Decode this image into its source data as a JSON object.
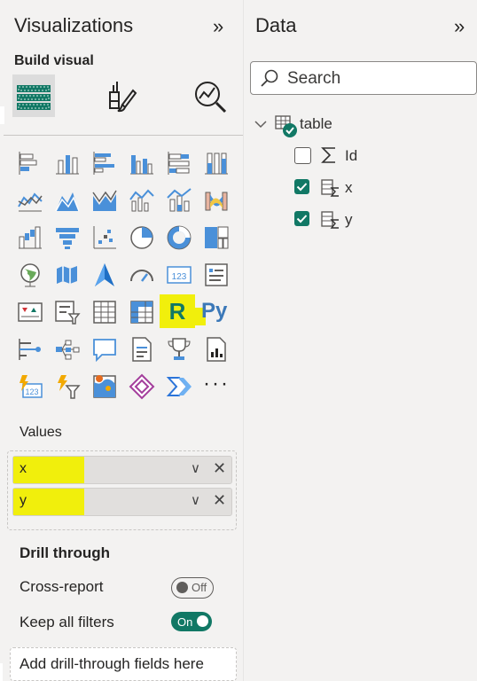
{
  "visualizations": {
    "title": "Visualizations",
    "build_label": "Build visual",
    "collapse_glyph": "»",
    "visual_icons": [
      "stacked-bar-icon",
      "stacked-column-icon",
      "clustered-bar-icon",
      "clustered-column-icon",
      "100-stacked-bar-icon",
      "100-stacked-column-icon",
      "line-chart-icon",
      "area-chart-icon",
      "stacked-area-icon",
      "line-clustered-column-icon",
      "line-stacked-column-icon",
      "ribbon-chart-icon",
      "waterfall-chart-icon",
      "funnel-icon",
      "scatter-chart-icon",
      "pie-chart-icon",
      "donut-chart-icon",
      "treemap-icon",
      "map-icon",
      "filled-map-icon",
      "azure-map-icon",
      "gauge-icon",
      "card-icon",
      "multi-row-card-icon",
      "kpi-icon",
      "slicer-icon",
      "table-icon",
      "matrix-icon",
      "r-script-visual-icon",
      "python-visual-icon",
      "key-influencers-icon",
      "decomposition-tree-icon",
      "qa-icon",
      "smart-narrative-icon",
      "metrics-icon",
      "paginated-report-icon",
      "power-apps-icon",
      "power-automate-icon",
      "arcgis-map-icon",
      "power-apps-icon-2",
      "power-automate-icon-2",
      "more-visuals-icon"
    ],
    "r_label": "R",
    "py_label": "Py",
    "more_label": "···",
    "values": {
      "label": "Values",
      "fields": [
        {
          "name": "x"
        },
        {
          "name": "y"
        }
      ],
      "chevron": "∨",
      "remove": "✕"
    },
    "drill": {
      "title": "Drill through",
      "cross_report_label": "Cross-report",
      "cross_report_toggle": "Off",
      "keep_filters_label": "Keep all filters",
      "keep_filters_toggle": "On",
      "add_fields": "Add drill-through fields here"
    }
  },
  "data_pane": {
    "title": "Data",
    "collapse_glyph": "»",
    "search_placeholder": "Search",
    "table_name": "table",
    "fields": [
      {
        "name": "Id",
        "checked": false,
        "icon": "sigma-icon"
      },
      {
        "name": "x",
        "checked": true,
        "icon": "calculated-column-icon"
      },
      {
        "name": "y",
        "checked": true,
        "icon": "calculated-column-icon"
      }
    ]
  },
  "colors": {
    "accent_teal": "#117865",
    "highlight_yellow": "#f1ef0c",
    "icon_blue": "#4a90d9",
    "pane_bg": "#f3f2f1"
  }
}
